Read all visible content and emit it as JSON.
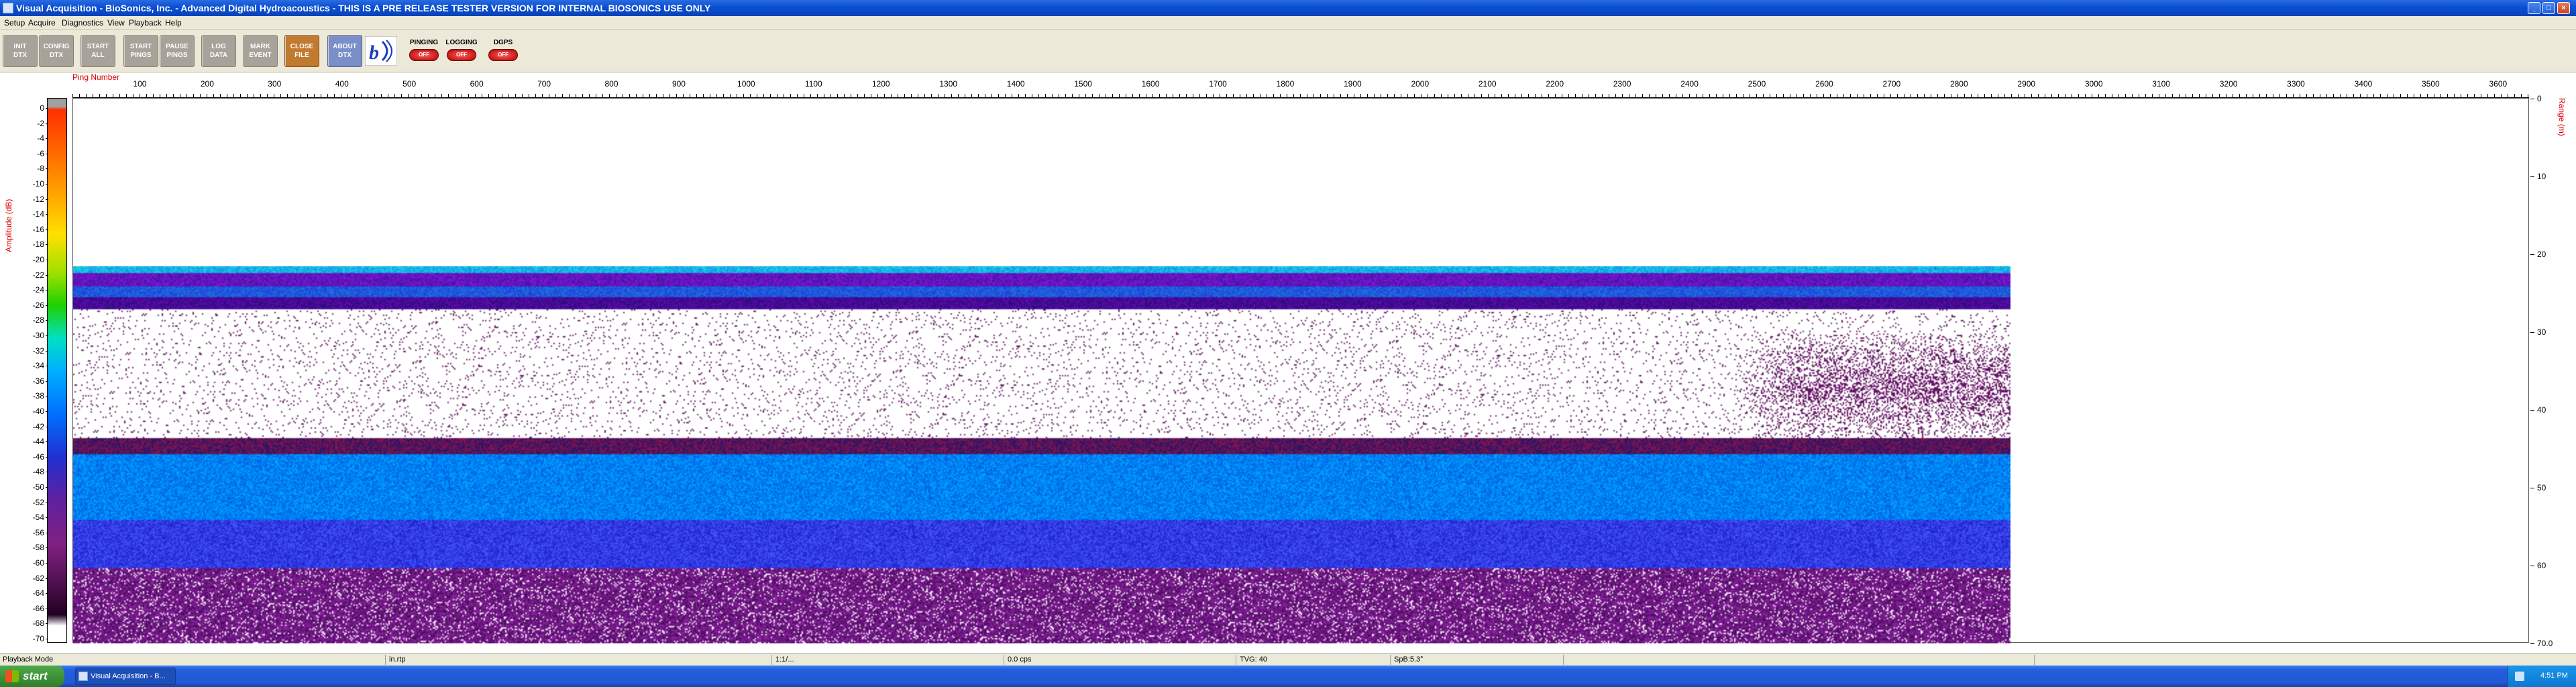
{
  "window": {
    "title": "Visual Acquisition  -  BioSonics, Inc.  -  Advanced Digital Hydroacoustics  -  THIS IS A PRE RELEASE TESTER VERSION FOR INTERNAL BIOSONICS USE ONLY",
    "min": "_",
    "max": "□",
    "close": "×"
  },
  "menu": [
    "Setup",
    "Acquire",
    "Diagnostics",
    "View",
    "Playback",
    "Help"
  ],
  "toolbar": {
    "buttons": [
      {
        "label1": "INIT",
        "label2": "DTX",
        "style": "gray"
      },
      {
        "label1": "CONFIG",
        "label2": "DTX",
        "style": "gray"
      },
      {
        "label1": "START",
        "label2": "ALL",
        "style": "gray"
      },
      {
        "label1": "START",
        "label2": "PINGS",
        "style": "gray"
      },
      {
        "label1": "PAUSE",
        "label2": "PINGS",
        "style": "gray"
      },
      {
        "label1": "LOG",
        "label2": "DATA",
        "style": "gray"
      },
      {
        "label1": "MARK",
        "label2": "EVENT",
        "style": "gray"
      },
      {
        "label1": "CLOSE",
        "label2": "FILE",
        "style": "orange"
      },
      {
        "label1": "ABOUT",
        "label2": "DTX",
        "style": "blue"
      }
    ],
    "logo_icon": "biosonics-logo-icon",
    "status": [
      {
        "label": "PINGING",
        "state": "OFF"
      },
      {
        "label": "LOGGING",
        "state": "OFF"
      },
      {
        "label": "DGPS",
        "state": "OFF"
      }
    ]
  },
  "echogram": {
    "x_axis_label": "Ping Number",
    "x_ticks": [
      "100",
      "200",
      "300",
      "400",
      "500",
      "600",
      "700",
      "800",
      "900",
      "1000",
      "1100",
      "1200",
      "1300",
      "1400",
      "1500",
      "1600",
      "1700",
      "1800",
      "1900",
      "2000",
      "2100",
      "2200",
      "2300",
      "2400",
      "2500",
      "2600",
      "2700",
      "2800",
      "2900",
      "3000",
      "3100",
      "3200",
      "3300",
      "3400",
      "3500",
      "3600"
    ],
    "amp_label": "Amplitude (dB)",
    "amp_ticks": [
      "0",
      "-2",
      "-4",
      "-6",
      "-8",
      "-10",
      "-12",
      "-14",
      "-16",
      "-18",
      "-20",
      "-22",
      "-24",
      "-26",
      "-28",
      "-30",
      "-32",
      "-34",
      "-36",
      "-38",
      "-40",
      "-42",
      "-44",
      "-46",
      "-48",
      "-50",
      "-52",
      "-54",
      "-56",
      "-58",
      "-60",
      "-62",
      "-64",
      "-66",
      "-68",
      "-70"
    ],
    "range_label": "Range (m)",
    "range_ticks": [
      "0",
      "10",
      "20",
      "30",
      "40",
      "50",
      "60",
      "70.0"
    ],
    "data_extent_pings": 2900,
    "surface_band_range_m": [
      21.5,
      27
    ],
    "bottom_band_range_m": [
      43.5,
      45.5
    ],
    "school_pings": [
      2480,
      2900
    ],
    "colors": {
      "surface": "#2040e0",
      "bottom": "#0080ff",
      "noise": "#5a1060"
    }
  },
  "status_bar": {
    "mode": "Playback Mode",
    "file": "in.rtp",
    "f3": "1:1/...",
    "rate": "0.0 cps",
    "tvg": "TVG: 40",
    "spl": "SpB:5.3°"
  },
  "taskbar": {
    "start": "start",
    "task": "Visual Acquisition  -  B...",
    "clock": "4:51 PM"
  }
}
